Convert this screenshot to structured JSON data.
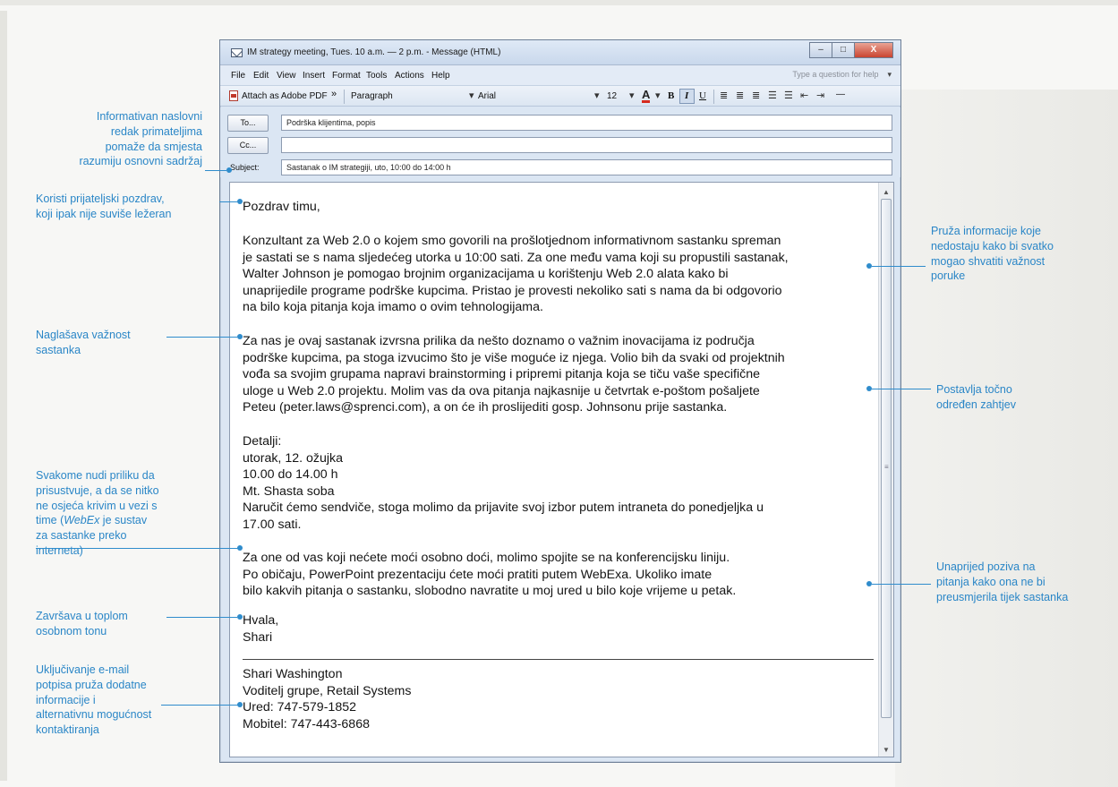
{
  "window": {
    "title": "IM strategy meeting, Tues. 10 a.m. — 2 p.m. - Message (HTML)",
    "controls": {
      "minimize": "–",
      "maximize": "□",
      "close": "X"
    }
  },
  "menu": {
    "items": [
      "File",
      "Edit",
      "View",
      "Insert",
      "Format",
      "Tools",
      "Actions",
      "Help"
    ],
    "help_placeholder": "Type a question for help"
  },
  "toolbar": {
    "attach_pdf": "Attach as Adobe PDF",
    "overflow": "»",
    "style": "Paragraph",
    "font": "Arial",
    "size": "12",
    "font_color_glyph": "A",
    "bold": "B",
    "italic": "I",
    "underline": "U",
    "more": "—"
  },
  "header": {
    "to_label": "To...",
    "to_value": "Podrška klijentima, popis",
    "cc_label": "Cc...",
    "cc_value": "",
    "subject_label": "Subject:",
    "subject_value": "Sastanak o IM strategiji, uto, 10:00 do 14:00 h"
  },
  "body": {
    "greeting": "Pozdrav timu,",
    "p1": "Konzultant za Web 2.0 o kojem smo govorili na prošlotjednom informativnom sastanku spreman\nje sastati se s nama sljedećeg utorka u 10:00 sati. Za one među vama koji su propustili sastanak,\nWalter Johnson je pomogao brojnim organizacijama u korištenju Web 2.0 alata kako bi\nunaprijedile programe podrške kupcima. Pristao je provesti nekoliko sati s nama da bi odgovorio\nna bilo koja pitanja koja imamo o ovim tehnologijama.",
    "p2": "Za nas je ovaj sastanak izvrsna prilika da nešto doznamo o važnim inovacijama iz područja\npodrške kupcima, pa stoga izvucimo što je više moguće iz njega. Volio bih da svaki od projektnih\nvođa sa svojim grupama napravi brainstorming i pripremi pitanja koja se tiču vaše specifične\nuloge u Web 2.0 projektu. Molim vas da ova pitanja najkasnije u četvrtak e-poštom pošaljete\nPeteu (peter.laws@sprenci.com), a on će ih proslijediti gosp. Johnsonu prije sastanka.",
    "details": "Detalji:\nutorak, 12. ožujka\n10.00 do 14.00 h\nMt. Shasta soba\nNaručit ćemo sendviče, stoga molimo da prijavite svoj izbor putem intraneta do ponedjeljka u\n17.00 sati.",
    "p3": "Za one od vas koji nećete moći osobno doći, molimo spojite se na konferencijsku liniju.\nPo običaju, PowerPoint prezentaciju ćete moći pratiti putem WebExa. Ukoliko imate\nbilo kakvih pitanja o sastanku, slobodno navratite u moj ured u bilo koje vrijeme u petak.",
    "closing": "Hvala,\nShari",
    "signature": "Shari Washington\nVoditelj grupe, Retail Systems\nUred: 747-579-1852\nMobitel: 747-443-6868"
  },
  "annotations": {
    "subject_note": "Informativan naslovni\nredak primateljima\npomaže da smjesta\nrazumiju osnovni sadržaj",
    "greeting_note": "Koristi prijateljski pozdrav,\nkoji ipak nije suviše ležeran",
    "importance_note": "Naglašava važnost\nsastanka",
    "webex_note_1": "Svakome nudi priliku da\nprisustvuje, a da se nitko\nne osjeća krivim u vezi s\ntime (",
    "webex_italic": "WebEx",
    "webex_note_2": " je sustav\nza sastanke preko\ninterneta)",
    "closing_note": "Završava u toplom\nosobnom tonu",
    "signature_note": "Uključivanje e-mail\npotpisa pruža dodatne\ninformacije i\nalternativnu mogućnost\nkontaktiranja",
    "info_note": "Pruža informacije koje\nnedostaju kako bi svatko\nmogao shvatiti važnost\nporuke",
    "request_note": "Postavlja točno\nodređen zahtjev",
    "questions_note": "Unaprijed poziva na\npitanja kako ona ne bi\npreusmjerila tijek sastanka"
  },
  "colors": {
    "annotation_blue": "#2a86c7",
    "window_frame": "#dbe6f3",
    "close_button": "#c94430"
  }
}
